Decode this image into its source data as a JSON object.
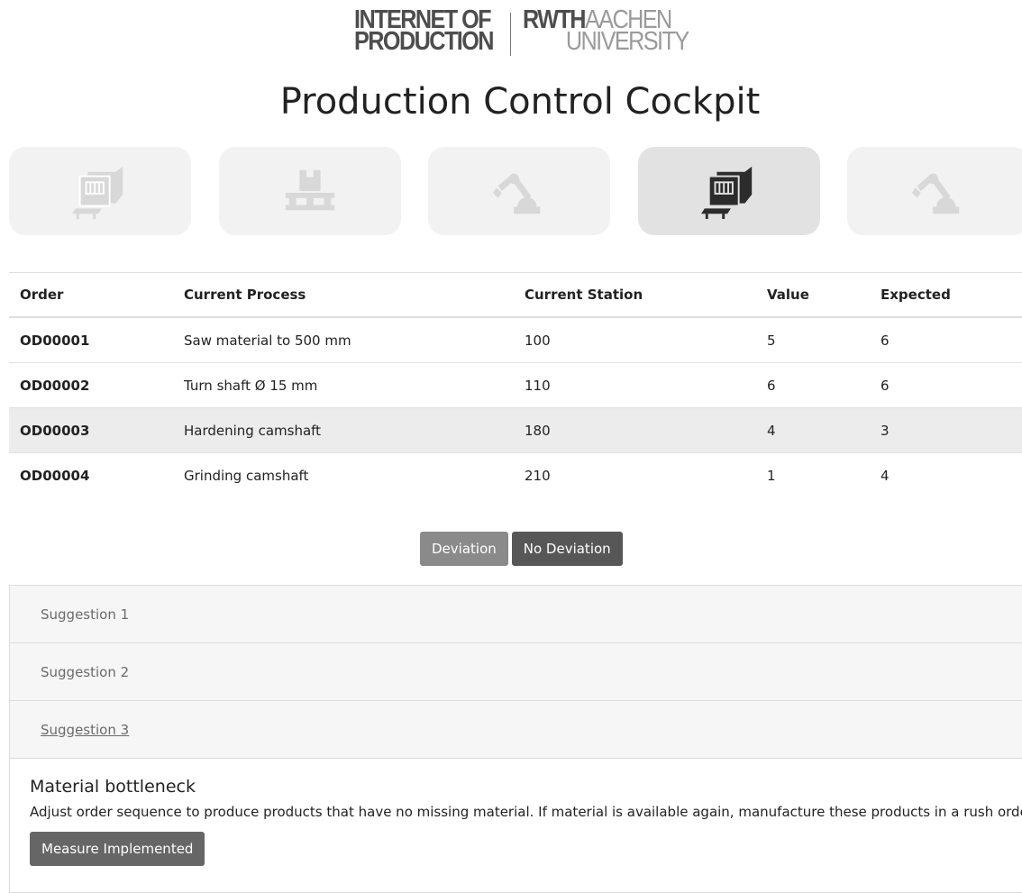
{
  "logos": {
    "iop_line1": "INTERNET OF",
    "iop_line2": "PRODUCTION",
    "rwth": "RWTH",
    "aachen": "AACHEN",
    "university": "UNIVERSITY"
  },
  "page": {
    "title": "Production Control Cockpit"
  },
  "stations": [
    {
      "icon": "machine-icon",
      "active": false
    },
    {
      "icon": "pallet-icon",
      "active": false
    },
    {
      "icon": "robot-arm-icon",
      "active": false
    },
    {
      "icon": "machine-icon",
      "active": true
    },
    {
      "icon": "robot-arm-icon",
      "active": false
    }
  ],
  "table": {
    "headers": [
      "Order",
      "Current Process",
      "Current Station",
      "Value",
      "Expected"
    ],
    "rows": [
      {
        "order": "OD00001",
        "process": "Saw material to 500 mm",
        "station": "100",
        "value": "5",
        "expected": "6"
      },
      {
        "order": "OD00002",
        "process": "Turn shaft Ø 15 mm",
        "station": "110",
        "value": "6",
        "expected": "6"
      },
      {
        "order": "OD00003",
        "process": "Hardening camshaft",
        "station": "180",
        "value": "4",
        "expected": "3"
      },
      {
        "order": "OD00004",
        "process": "Grinding camshaft",
        "station": "210",
        "value": "1",
        "expected": "4"
      }
    ]
  },
  "buttons": {
    "deviation": "Deviation",
    "no_deviation": "No Deviation"
  },
  "suggestions": [
    {
      "label": "Suggestion 1"
    },
    {
      "label": "Suggestion 2"
    },
    {
      "label": "Suggestion 3"
    }
  ],
  "detail": {
    "title": "Material bottleneck",
    "text": "Adjust order sequence to produce products that have no missing material. If material is available again, manufacture these products in a rush order.",
    "button": "Measure Implemented"
  },
  "colors": {
    "active_tile": "#e2e2e2",
    "inactive_tile": "#f2f2f2",
    "button_dark": "#575757",
    "button_light": "#8a8a8a"
  }
}
